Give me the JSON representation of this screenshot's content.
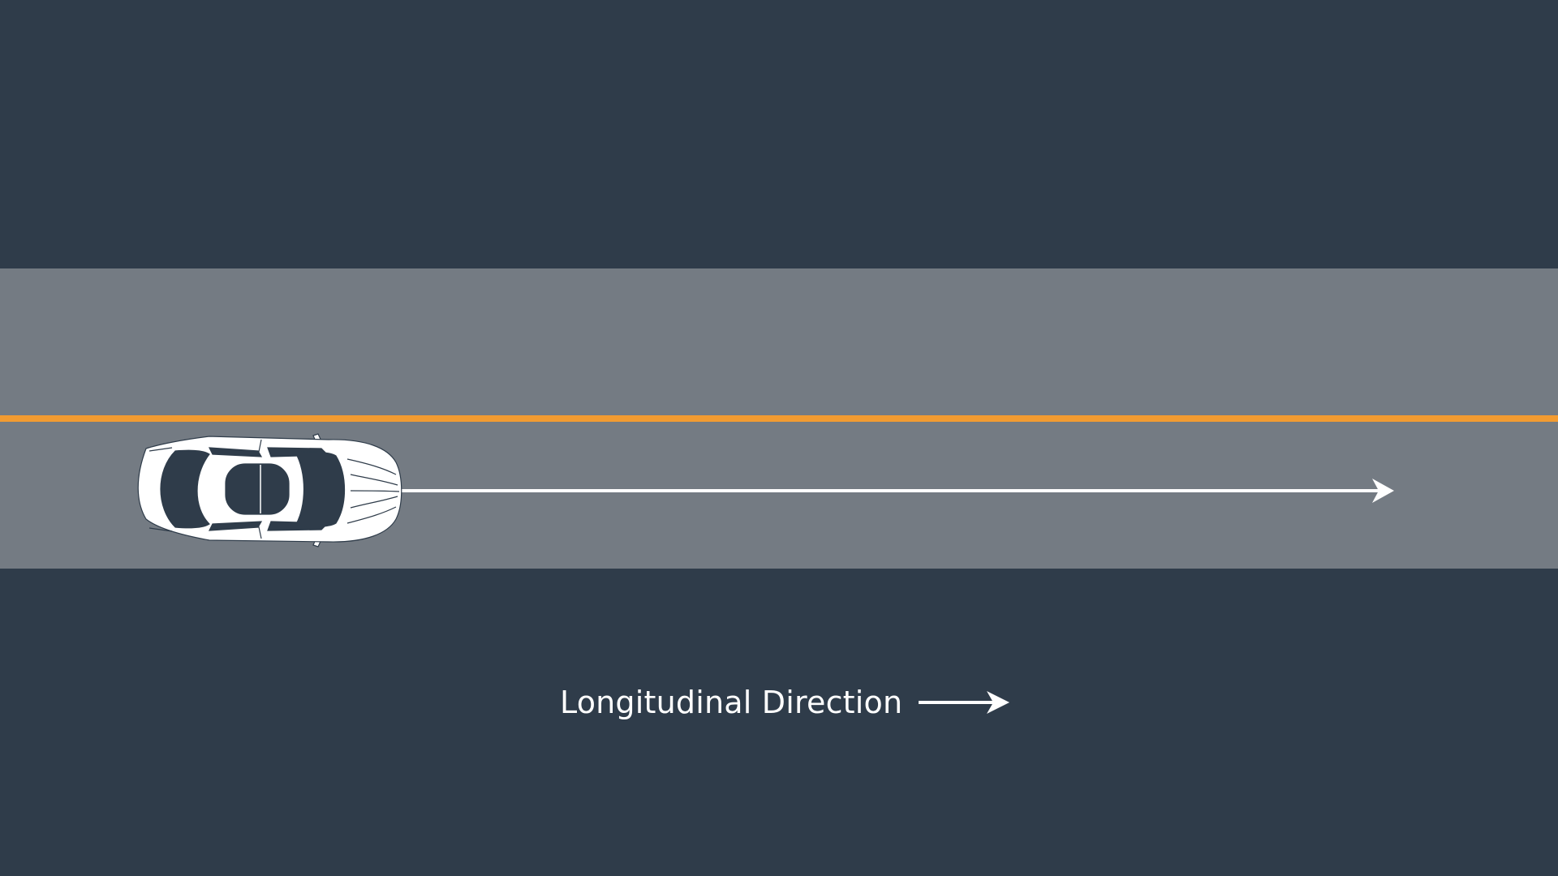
{
  "diagram": {
    "colors": {
      "background": "#2f3c4a",
      "road": "#747b83",
      "lane_marking": "#f29b31",
      "arrow": "#ffffff",
      "car_body": "#ffffff",
      "car_glass": "#2f3c4a"
    },
    "vehicle": {
      "icon": "car-top-view-icon",
      "heading": "right"
    },
    "motion_arrow": {
      "icon": "long-arrow-right-icon"
    },
    "caption": {
      "text": "Longitudinal Direction",
      "icon": "arrow-right-icon"
    }
  }
}
